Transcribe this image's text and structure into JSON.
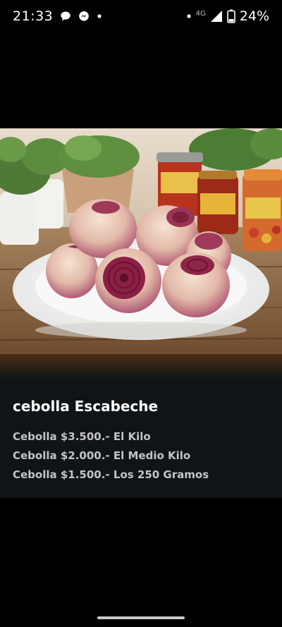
{
  "status_bar": {
    "time": "21:33",
    "network": "4G",
    "battery": "24%",
    "icons": [
      "chat-bubble-icon",
      "messenger-icon",
      "dot-icon",
      "dot-icon",
      "signal-icon",
      "battery-icon"
    ]
  },
  "product": {
    "image_icon": "onion-plate-photo",
    "title": "cebolla Escabeche",
    "prices": [
      "Cebolla $3.500.- El Kilo",
      "Cebolla $2.000.- El Medio Kilo",
      "Cebolla $1.500.- Los 250 Gramos"
    ]
  },
  "colors": {
    "background": "#000000",
    "panel": "#111417",
    "price_text": "#c2c4c6"
  }
}
